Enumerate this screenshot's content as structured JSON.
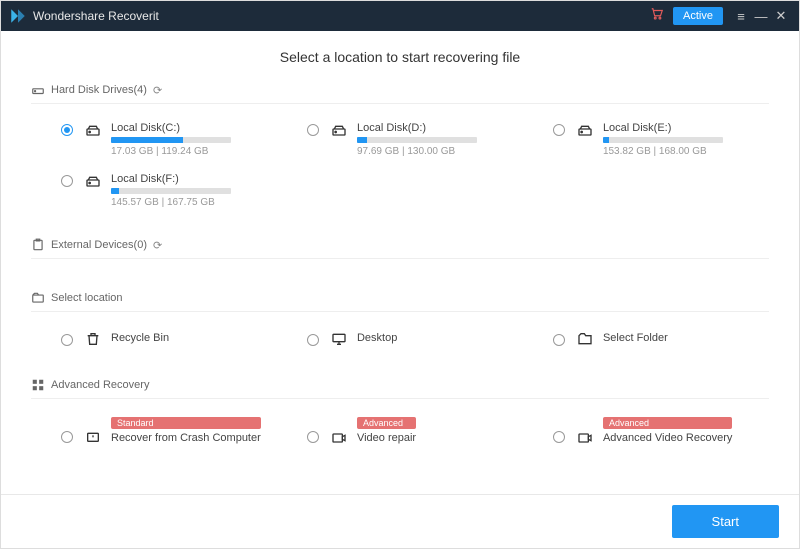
{
  "title": "Wondershare Recoverit",
  "active_label": "Active",
  "heading": "Select a location to start recovering file",
  "sections": {
    "hdd": {
      "label": "Hard Disk Drives(4)"
    },
    "ext": {
      "label": "External Devices(0)"
    },
    "sel": {
      "label": "Select location"
    },
    "adv": {
      "label": "Advanced Recovery"
    }
  },
  "disks": [
    {
      "name": "Local Disk(C:)",
      "size": "17.03 GB | 119.24 GB",
      "pct": 60,
      "selected": true
    },
    {
      "name": "Local Disk(D:)",
      "size": "97.69 GB | 130.00 GB",
      "pct": 8,
      "selected": false
    },
    {
      "name": "Local Disk(E:)",
      "size": "153.82 GB | 168.00 GB",
      "pct": 5,
      "selected": false
    },
    {
      "name": "Local Disk(F:)",
      "size": "145.57 GB | 167.75 GB",
      "pct": 7,
      "selected": false
    }
  ],
  "locations": [
    {
      "name": "Recycle Bin"
    },
    {
      "name": "Desktop"
    },
    {
      "name": "Select Folder"
    }
  ],
  "advanced": [
    {
      "badge": "Standard",
      "name": "Recover from Crash Computer"
    },
    {
      "badge": "Advanced",
      "name": "Video repair"
    },
    {
      "badge": "Advanced",
      "name": "Advanced Video Recovery"
    }
  ],
  "start_label": "Start"
}
